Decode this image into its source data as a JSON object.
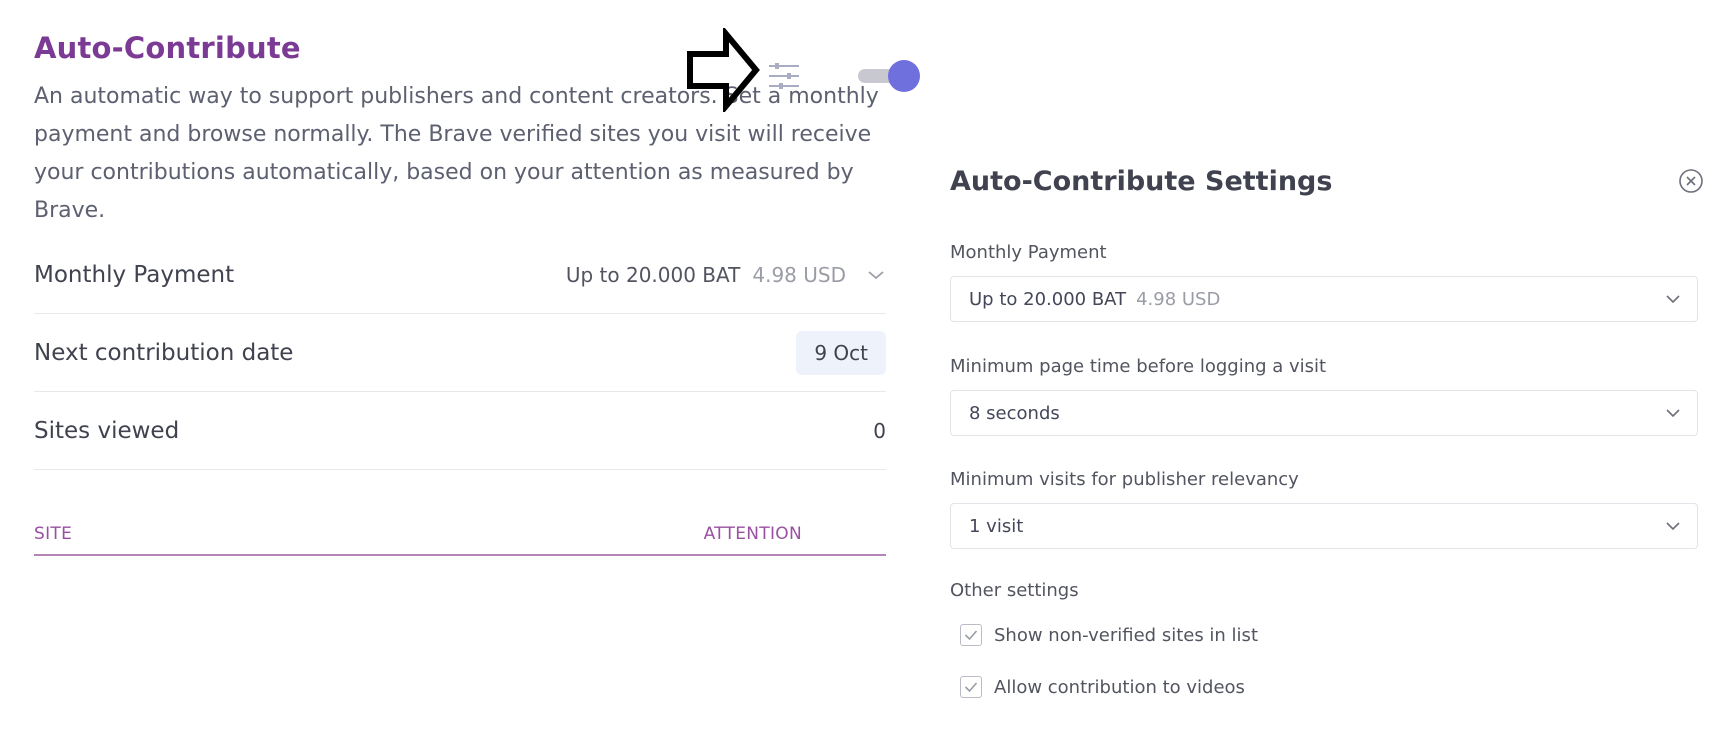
{
  "auto_contribute": {
    "title": "Auto-Contribute",
    "description": "An automatic way to support publishers and content creators. Set a monthly payment and browse normally. The Brave verified sites you visit will receive your contributions automatically, based on your attention as measured by Brave.",
    "toggle_on": true,
    "rows": {
      "monthly_payment": {
        "label": "Monthly Payment",
        "value": "Up to 20.000 BAT",
        "usd": "4.98 USD"
      },
      "next_contribution": {
        "label": "Next contribution date",
        "value": "9 Oct"
      },
      "sites_viewed": {
        "label": "Sites viewed",
        "value": "0"
      }
    },
    "table": {
      "col_site": "SITE",
      "col_attention": "ATTENTION"
    }
  },
  "settings": {
    "title": "Auto-Contribute Settings",
    "monthly_payment": {
      "label": "Monthly Payment",
      "value": "Up to 20.000 BAT",
      "usd": "4.98 USD"
    },
    "min_page_time": {
      "label": "Minimum page time before logging a visit",
      "value": "8 seconds"
    },
    "min_visits": {
      "label": "Minimum visits for publisher relevancy",
      "value": "1 visit"
    },
    "other": {
      "label": "Other settings",
      "show_non_verified": {
        "label": "Show non-verified sites in list",
        "checked": true
      },
      "allow_videos": {
        "label": "Allow contribution to videos",
        "checked": true
      }
    }
  },
  "colors": {
    "accent_purple": "#7b3a93",
    "toggle_blue": "#6f6fde"
  }
}
